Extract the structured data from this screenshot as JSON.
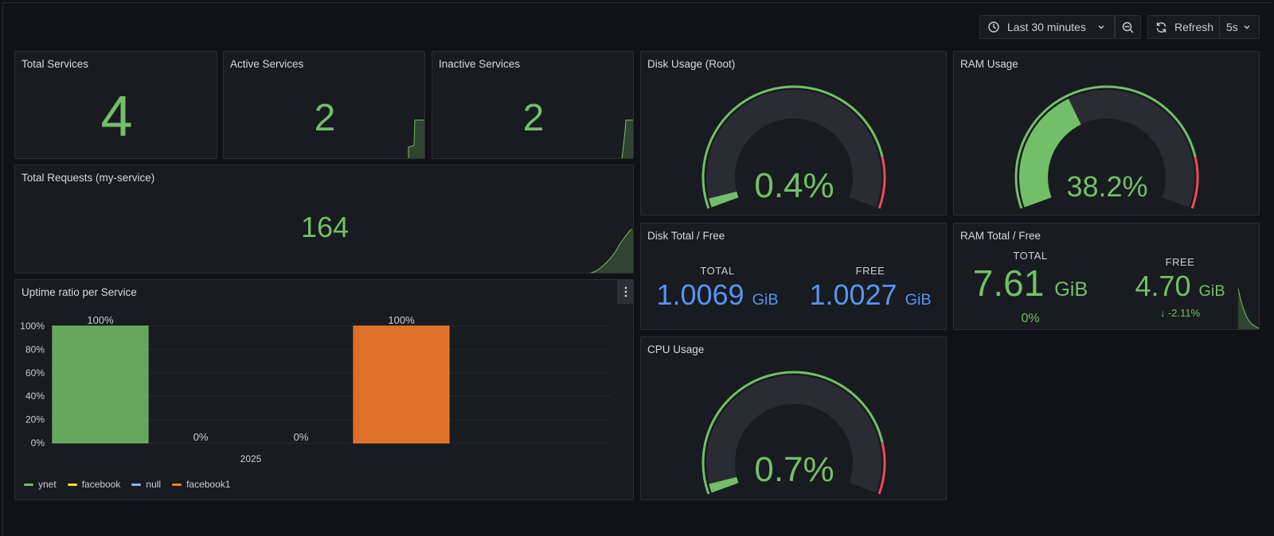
{
  "toolbar": {
    "time_range": "Last 30 minutes",
    "refresh_label": "Refresh",
    "refresh_interval": "5s"
  },
  "stats": {
    "total_services": {
      "title": "Total Services",
      "value": "4"
    },
    "active_services": {
      "title": "Active Services",
      "value": "2"
    },
    "inactive_services": {
      "title": "Inactive Services",
      "value": "2"
    },
    "total_requests": {
      "title": "Total Requests (my-service)",
      "value": "164"
    }
  },
  "gauges": {
    "disk": {
      "title": "Disk Usage (Root)",
      "value_text": "0.4%",
      "value": 0.4
    },
    "ram": {
      "title": "RAM Usage",
      "value_text": "38.2%",
      "value": 38.2
    },
    "cpu": {
      "title": "CPU Usage",
      "value_text": "0.7%",
      "value": 0.7
    }
  },
  "disk_total_free": {
    "title": "Disk Total / Free",
    "total_label": "TOTAL",
    "total_value": "1.0069",
    "total_unit": "GiB",
    "free_label": "FREE",
    "free_value": "1.0027",
    "free_unit": "GiB"
  },
  "ram_total_free": {
    "title": "RAM Total / Free",
    "total_label": "TOTAL",
    "total_value": "7.61",
    "total_unit": "GiB",
    "total_change": "0%",
    "free_label": "FREE",
    "free_value": "4.70",
    "free_unit": "GiB",
    "free_change": "-2.11%"
  },
  "uptime": {
    "title": "Uptime ratio per Service"
  },
  "colors": {
    "green": "#73bf69",
    "red": "#f2495c",
    "blue": "#5794f2",
    "orange": "#ff7f2a",
    "yellow": "#fade2a"
  },
  "chart_data": {
    "type": "bar",
    "categories": [
      "2025"
    ],
    "series": [
      {
        "name": "ynet",
        "values": [
          100
        ],
        "label": "100%",
        "color": "#73bf69"
      },
      {
        "name": "facebook",
        "values": [
          0
        ],
        "label": "0%",
        "color": "#fade2a"
      },
      {
        "name": "null",
        "values": [
          0
        ],
        "label": "0%",
        "color": "#8ab8ff"
      },
      {
        "name": "facebook1",
        "values": [
          100
        ],
        "label": "100%",
        "color": "#ff7f2a"
      }
    ],
    "yticks": [
      "0%",
      "20%",
      "40%",
      "60%",
      "80%",
      "100%"
    ],
    "ylim": [
      0,
      100
    ],
    "legend": "bottom-left"
  }
}
